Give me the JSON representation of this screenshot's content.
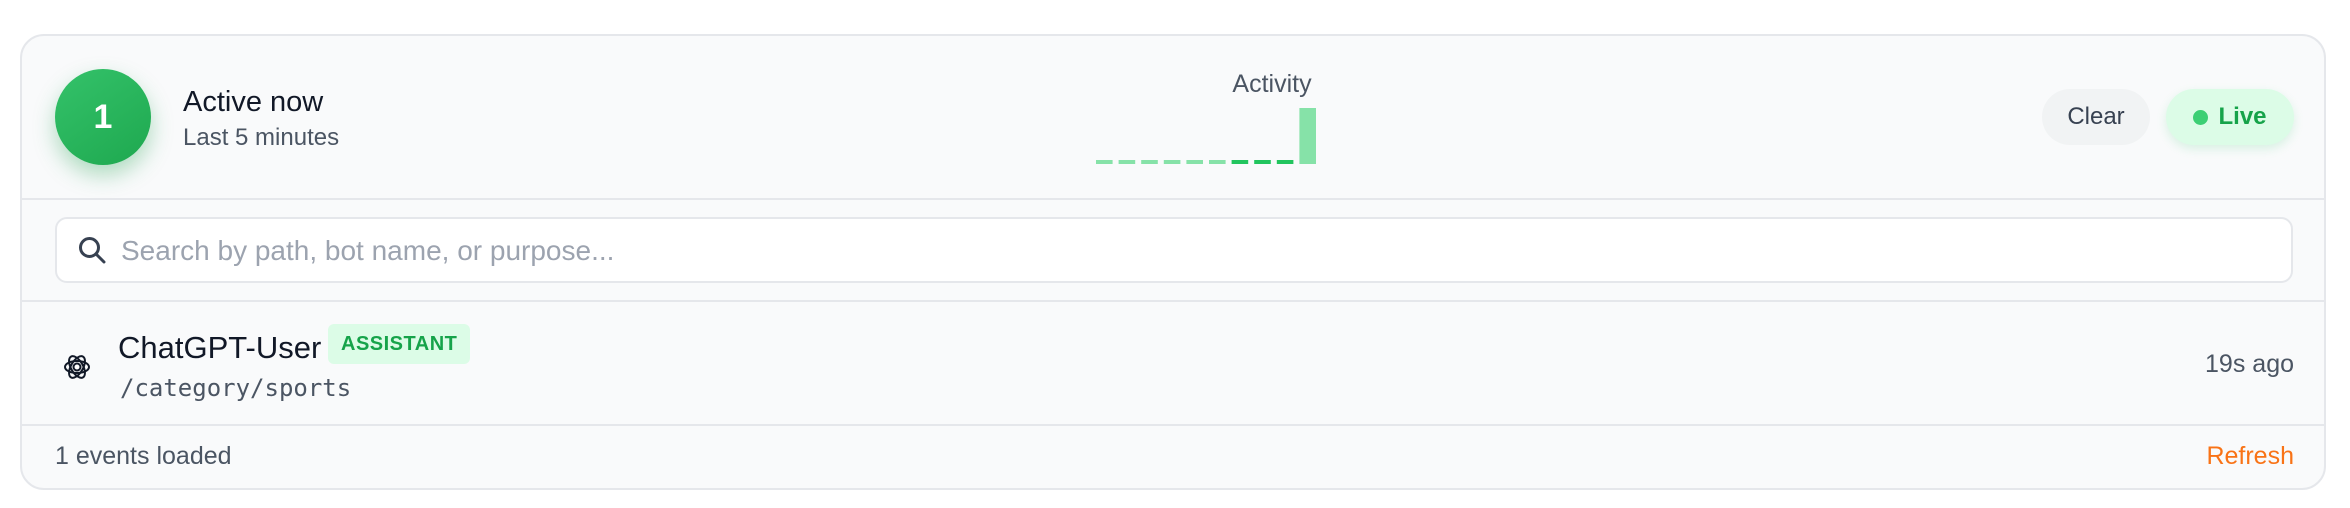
{
  "header": {
    "count": "1",
    "title": "Active now",
    "subtitle": "Last 5 minutes",
    "activity_label": "Activity",
    "clear_label": "Clear",
    "live_label": "Live"
  },
  "activity": {
    "values": [
      0,
      0,
      0,
      0,
      0,
      0,
      0,
      0,
      0,
      1
    ],
    "bar_color_empty": "#86e2a8",
    "bar_color_active": "#22c55e"
  },
  "search": {
    "placeholder": "Search by path, bot name, or purpose...",
    "value": ""
  },
  "events": [
    {
      "bot": "ChatGPT-User",
      "icon": "openai-icon",
      "badge": "ASSISTANT",
      "path": "/category/sports",
      "time": "19s ago"
    }
  ],
  "footer": {
    "events_loaded": "1 events loaded",
    "refresh_label": "Refresh"
  },
  "colors": {
    "accent": "#22c55e",
    "live_bg": "#dcfce7",
    "refresh": "#f97316"
  }
}
